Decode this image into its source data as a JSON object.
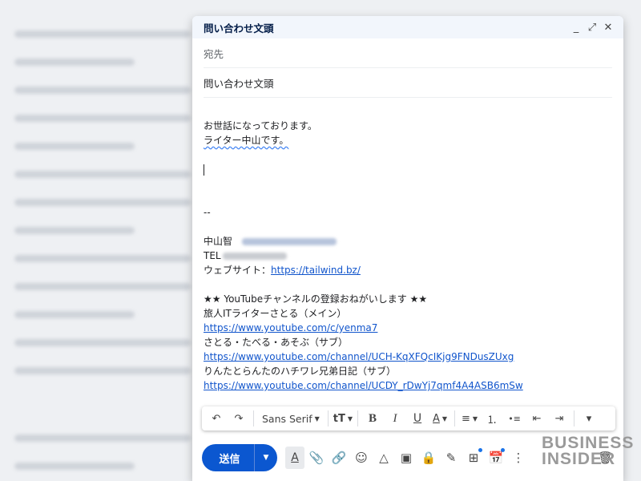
{
  "compose": {
    "title": "問い合わせ文頭",
    "to_placeholder": "宛先",
    "subject": "問い合わせ文頭",
    "window_controls": {
      "minimize": "_",
      "fullscreen": "⤢",
      "close": "✕"
    }
  },
  "body": {
    "greeting1": "お世話になっております。",
    "greeting2": "ライター中山です。",
    "sig_dash": "--",
    "sig_name": "中山智",
    "sig_tel": "TEL",
    "sig_web_label": "ウェブサイト：",
    "sig_web_link": "https://tailwind.bz/",
    "yt_heading": " ★★ YouTubeチャンネルの登録おねがいします ★★",
    "ch1_name": "旅人ITライターさとる（メイン）",
    "ch1_link": "https://www.youtube.com/c/yenma7",
    "ch2_name": "さとる・たべる・あそぶ（サブ）",
    "ch2_link": "https://www.youtube.com/channel/UCH-KqXFQcIKjg9FNDusZUxg",
    "ch3_name": "りんたとらんたのハチワレ兄弟日記（サブ）",
    "ch3_link": "https://www.youtube.com/channel/UCDY_rDwYj7qmf4A4ASB6mSw"
  },
  "toolbar": {
    "undo": "↶",
    "redo": "↷",
    "font": "Sans Serif",
    "size": "tT",
    "bold": "B",
    "italic": "I",
    "underline": "U",
    "text_color": "A",
    "align": "≡",
    "numbered": "⒈",
    "bulleted": "•≡",
    "indent_less": "⇤",
    "indent_more": "⇥",
    "more": "▾"
  },
  "actions": {
    "send_label": "送信"
  },
  "watermark": {
    "line1": "BUSINESS",
    "line2": "INSIDER"
  },
  "colors": {
    "accent": "#0b57d0",
    "link": "#1155cc",
    "titlebar": "#f2f6fc"
  }
}
